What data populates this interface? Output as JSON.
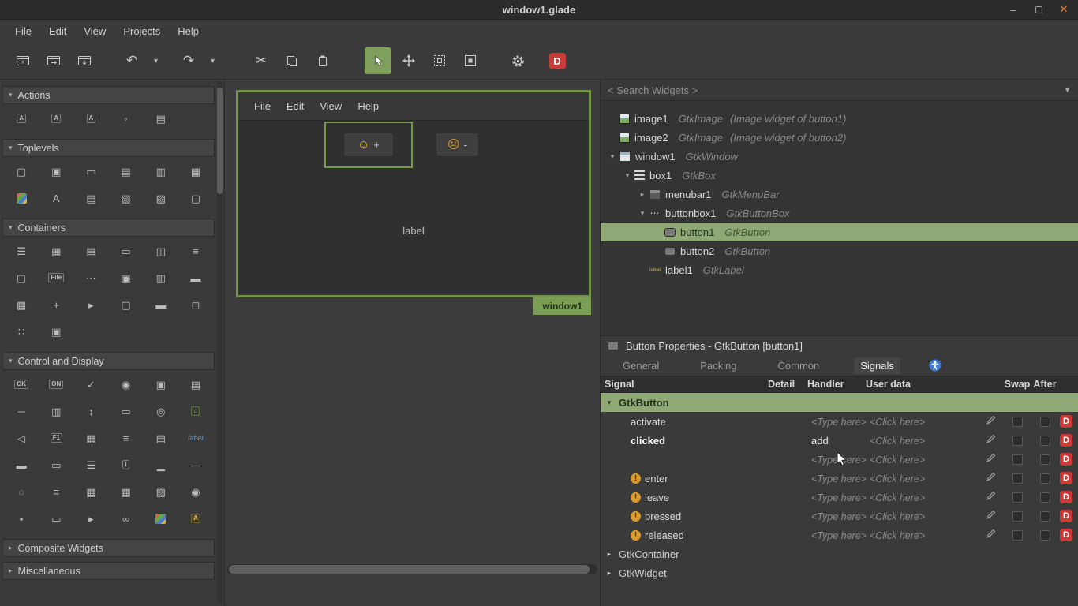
{
  "titlebar": {
    "title": "window1.glade"
  },
  "menubar": {
    "items": [
      "File",
      "Edit",
      "View",
      "Projects",
      "Help"
    ]
  },
  "palette": {
    "sections": [
      {
        "label": "Actions",
        "expanded": true,
        "items": [
          {
            "n": "action",
            "g": "A",
            "cls": "t"
          },
          {
            "n": "toggle-action",
            "g": "A",
            "cls": "t"
          },
          {
            "n": "radio-action",
            "g": "A",
            "cls": "t"
          },
          {
            "n": "recent-action",
            "g": "◦"
          },
          {
            "n": "action-group",
            "g": "▤"
          }
        ]
      },
      {
        "label": "Toplevels",
        "expanded": true,
        "items": [
          {
            "n": "window",
            "g": "▢"
          },
          {
            "n": "application-window",
            "g": "▣"
          },
          {
            "n": "dialog",
            "g": "▭"
          },
          {
            "n": "about-dialog",
            "g": "▤"
          },
          {
            "n": "file-chooser-dialog",
            "g": "▥"
          },
          {
            "n": "message-dialog",
            "g": "▦"
          },
          {
            "n": "color-chooser-dialog",
            "g": "■",
            "cls": "colorful"
          },
          {
            "n": "font-chooser-dialog",
            "g": "A"
          },
          {
            "n": "recent-chooser-dialog",
            "g": "▤"
          },
          {
            "n": "assistant",
            "g": "▧"
          },
          {
            "n": "app-chooser-dialog",
            "g": "▨"
          },
          {
            "n": "offscreen-window",
            "g": "▢"
          }
        ]
      },
      {
        "label": "Containers",
        "expanded": true,
        "items": [
          {
            "n": "box",
            "g": "☰"
          },
          {
            "n": "grid",
            "g": "▦"
          },
          {
            "n": "notebook",
            "g": "▤"
          },
          {
            "n": "frame",
            "g": "▭"
          },
          {
            "n": "paned",
            "g": "◫"
          },
          {
            "n": "list-box",
            "g": "≡"
          },
          {
            "n": "scrolled-window",
            "g": "▢"
          },
          {
            "n": "menu-bar",
            "g": "File",
            "cls": "t"
          },
          {
            "n": "button-box",
            "g": "⋯"
          },
          {
            "n": "stack",
            "g": "▣"
          },
          {
            "n": "stack-switcher",
            "g": "▥"
          },
          {
            "n": "toolbar",
            "g": "▬"
          },
          {
            "n": "layout",
            "g": "▦"
          },
          {
            "n": "fixed",
            "g": "+"
          },
          {
            "n": "expander",
            "g": "▸"
          },
          {
            "n": "viewport",
            "g": "▢"
          },
          {
            "n": "header-bar",
            "g": "▬"
          },
          {
            "n": "aspect-frame",
            "g": "◻"
          },
          {
            "n": "flow-box",
            "g": "∷"
          },
          {
            "n": "overlay",
            "g": "▣"
          }
        ]
      },
      {
        "label": "Control and Display",
        "expanded": true,
        "items": [
          {
            "n": "button",
            "g": "OK",
            "cls": "t"
          },
          {
            "n": "toggle-button",
            "g": "ON",
            "cls": "t"
          },
          {
            "n": "check-button",
            "g": "✓"
          },
          {
            "n": "radio-button",
            "g": "◉"
          },
          {
            "n": "switch",
            "g": "▣"
          },
          {
            "n": "combo-box",
            "g": "▤"
          },
          {
            "n": "scale",
            "g": "─"
          },
          {
            "n": "scrollbar",
            "g": "▥"
          },
          {
            "n": "spin-button",
            "g": "↕"
          },
          {
            "n": "entry",
            "g": "▭"
          },
          {
            "n": "search-entry",
            "g": "◎"
          },
          {
            "n": "file-chooser-button",
            "g": "⌂",
            "cls": "green t"
          },
          {
            "n": "volume-button",
            "g": "◁"
          },
          {
            "n": "accel-label",
            "g": "F1",
            "cls": "t"
          },
          {
            "n": "image",
            "g": "▦"
          },
          {
            "n": "text-view",
            "g": "≡"
          },
          {
            "n": "combo-box-text",
            "g": "▤"
          },
          {
            "n": "label",
            "g": "label",
            "cls": "blue"
          },
          {
            "n": "progress-bar",
            "g": "▬"
          },
          {
            "n": "level-bar",
            "g": "▭"
          },
          {
            "n": "menu-button",
            "g": "☰"
          },
          {
            "n": "info-bar",
            "g": "i",
            "cls": "t"
          },
          {
            "n": "statusbar",
            "g": "▁"
          },
          {
            "n": "separator",
            "g": "—"
          },
          {
            "n": "spinner",
            "g": "◌"
          },
          {
            "n": "tree-view",
            "g": "≡"
          },
          {
            "n": "icon-view",
            "g": "▦"
          },
          {
            "n": "calendar",
            "g": "▦"
          },
          {
            "n": "drawing-area",
            "g": "▨"
          },
          {
            "n": "scale-button",
            "g": "◉"
          },
          {
            "n": "lock-button",
            "g": "▪"
          },
          {
            "n": "app-chooser-button",
            "g": "▭"
          },
          {
            "n": "arrow",
            "g": "▸"
          },
          {
            "n": "link-button",
            "g": "∞"
          },
          {
            "n": "color-button",
            "g": "●",
            "cls": "colorful"
          },
          {
            "n": "font-button",
            "g": "A",
            "cls": "yellow t"
          }
        ]
      },
      {
        "label": "Composite Widgets",
        "expanded": false,
        "items": []
      },
      {
        "label": "Miscellaneous",
        "expanded": false,
        "items": []
      }
    ]
  },
  "canvas": {
    "design_menubar": [
      "File",
      "Edit",
      "View",
      "Help"
    ],
    "button1": {
      "emoji": "☺",
      "label": "+"
    },
    "button2": {
      "emoji": "☹",
      "label": "-"
    },
    "label_text": "label",
    "window_tag": "window1"
  },
  "inspector": {
    "search_placeholder": "< Search Widgets >",
    "rows": [
      {
        "name": "image1",
        "cls": "GtkImage",
        "note": "(Image widget of button1)",
        "depth": 0,
        "icon": "image"
      },
      {
        "name": "image2",
        "cls": "GtkImage",
        "note": "(Image widget of button2)",
        "depth": 0,
        "icon": "image"
      },
      {
        "name": "window1",
        "cls": "GtkWindow",
        "depth": 0,
        "icon": "window",
        "expander": "open"
      },
      {
        "name": "box1",
        "cls": "GtkBox",
        "depth": 1,
        "icon": "box",
        "expander": "open"
      },
      {
        "name": "menubar1",
        "cls": "GtkMenuBar",
        "depth": 2,
        "icon": "menubar",
        "expander": "closed"
      },
      {
        "name": "buttonbox1",
        "cls": "GtkButtonBox",
        "depth": 2,
        "icon": "buttonbox",
        "expander": "open"
      },
      {
        "name": "button1",
        "cls": "GtkButton",
        "depth": 3,
        "icon": "button",
        "selected": true
      },
      {
        "name": "button2",
        "cls": "GtkButton",
        "depth": 3,
        "icon": "button"
      },
      {
        "name": "label1",
        "cls": "GtkLabel",
        "depth": 2,
        "icon": "label"
      }
    ]
  },
  "properties": {
    "title": "Button Properties - GtkButton [button1]",
    "tabs": [
      {
        "label": "General"
      },
      {
        "label": "Packing"
      },
      {
        "label": "Common"
      },
      {
        "label": "Signals",
        "active": true
      }
    ],
    "signals": {
      "columns": [
        "Signal",
        "Detail",
        "Handler",
        "User data",
        "Swap",
        "After"
      ],
      "placeholder_handler": "<Type here>",
      "placeholder_user": "<Click here>",
      "rows": [
        {
          "type": "group",
          "label": "GtkButton",
          "expanded": true,
          "highlight": true
        },
        {
          "type": "signal",
          "name": "activate"
        },
        {
          "type": "signal",
          "name": "clicked",
          "bold": true,
          "handler": "add"
        },
        {
          "type": "signal",
          "name": ""
        },
        {
          "type": "signal",
          "name": "enter",
          "deprecated": true
        },
        {
          "type": "signal",
          "name": "leave",
          "deprecated": true
        },
        {
          "type": "signal",
          "name": "pressed",
          "deprecated": true
        },
        {
          "type": "signal",
          "name": "released",
          "deprecated": true
        },
        {
          "type": "group",
          "label": "GtkContainer",
          "expanded": false
        },
        {
          "type": "group",
          "label": "GtkWidget",
          "expanded": false
        }
      ]
    }
  },
  "colors": {
    "accent": "#8fa876",
    "danger": "#c93a3a",
    "warning": "#d79a28",
    "canvas_selection": "#76994e"
  }
}
